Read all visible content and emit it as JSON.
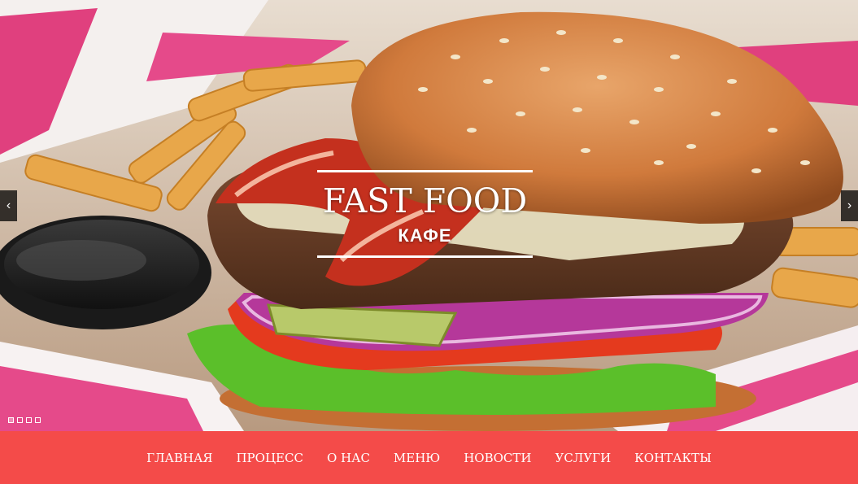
{
  "hero": {
    "title": "FAST FOOD",
    "subtitle": "КАФЕ",
    "prev_arrow": "‹",
    "next_arrow": "›",
    "slides": 4,
    "active_slide": 1,
    "image_description_icon": "burger-photo"
  },
  "nav": {
    "items": [
      {
        "label": "ГЛАВНАЯ"
      },
      {
        "label": "ПРОЦЕСС"
      },
      {
        "label": "О НАС"
      },
      {
        "label": "МЕНЮ"
      },
      {
        "label": "НОВОСТИ"
      },
      {
        "label": "УСЛУГИ"
      },
      {
        "label": "КОНТАКТЫ"
      }
    ],
    "background": "#f44b49"
  }
}
